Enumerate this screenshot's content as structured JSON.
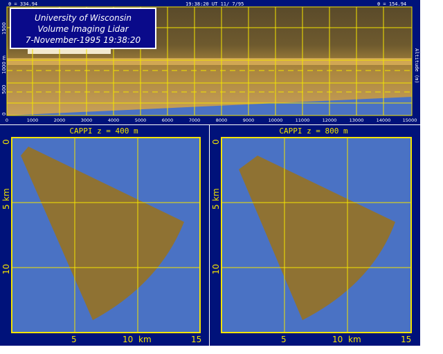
{
  "top_panel": {
    "title_lines": [
      "University of Wisconsin",
      "Volume Imaging Lidar",
      "7-November-1995 19:38:20"
    ],
    "left_readout": "θ = 334.94",
    "center_readout": "19:38:20 UT 11/ 7/95",
    "right_readout": "θ = 154.94",
    "right_axis_label": "Altitude (m)",
    "y_ticks": [
      "0",
      "500",
      "1000 m",
      "1500"
    ],
    "x_ticks": [
      "0",
      "1000",
      "2000",
      "3000",
      "4000",
      "5000",
      "6000",
      "7000",
      "8000",
      "9000",
      "10000",
      "11000",
      "12000",
      "13000",
      "14000",
      "15000"
    ]
  },
  "panels": [
    {
      "title": "CAPPI  z = 400 m",
      "y_ticks": [
        "0",
        "5",
        "km",
        "10"
      ],
      "x_ticks": [
        "5",
        "10",
        "km",
        "15"
      ]
    },
    {
      "title": "CAPPI  z = 800 m",
      "y_ticks": [
        "0",
        "5",
        "km",
        "10"
      ],
      "x_ticks": [
        "5",
        "10",
        "km",
        "15"
      ]
    }
  ],
  "colors": {
    "frame": "#00127a",
    "plot_background": "#4a72c4",
    "grid": "#f4e400",
    "lidar_sector": "#8f7233",
    "title_box": "#0a0a8a"
  }
}
